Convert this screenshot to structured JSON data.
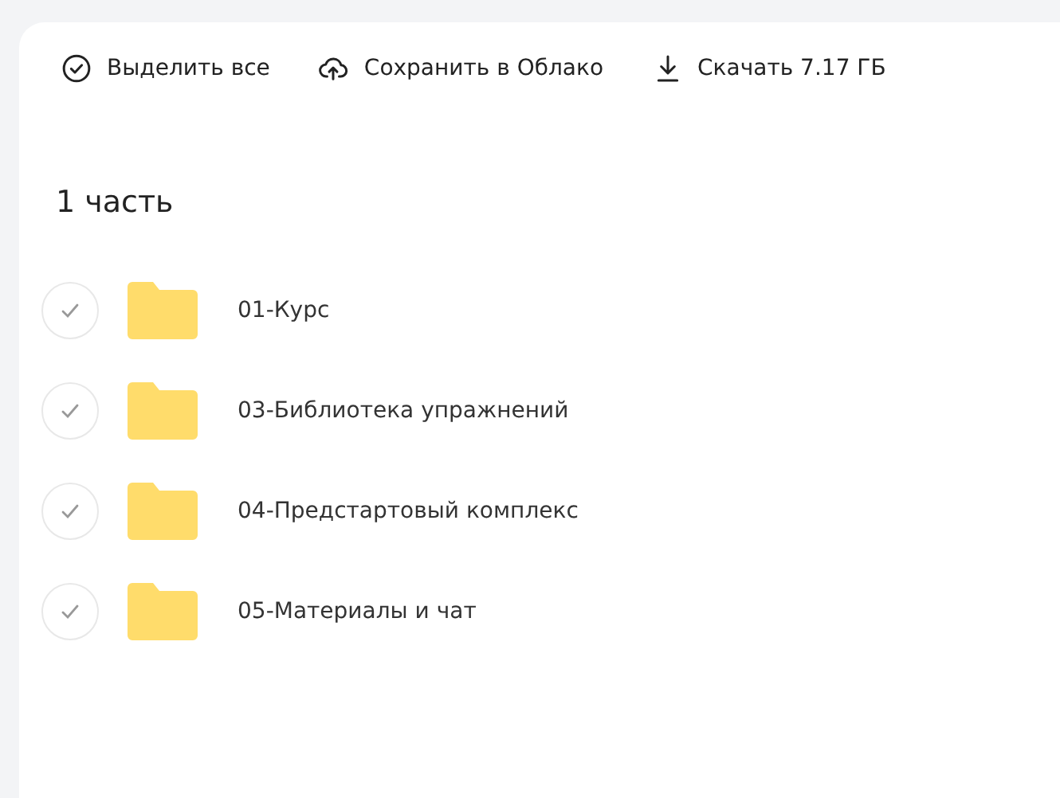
{
  "toolbar": [
    {
      "kind": "select",
      "label": "Выделить все"
    },
    {
      "kind": "cloud",
      "label": "Сохранить в Облако"
    },
    {
      "kind": "download",
      "label": "Скачать 7.17 ГБ"
    }
  ],
  "title": "1 часть",
  "items": [
    {
      "name": "01-Курс",
      "selected": false
    },
    {
      "name": "03-Библиотека упражнений",
      "selected": false
    },
    {
      "name": "04-Предстартовый комплекс",
      "selected": false
    },
    {
      "name": "05-Материалы и чат",
      "selected": false
    }
  ]
}
